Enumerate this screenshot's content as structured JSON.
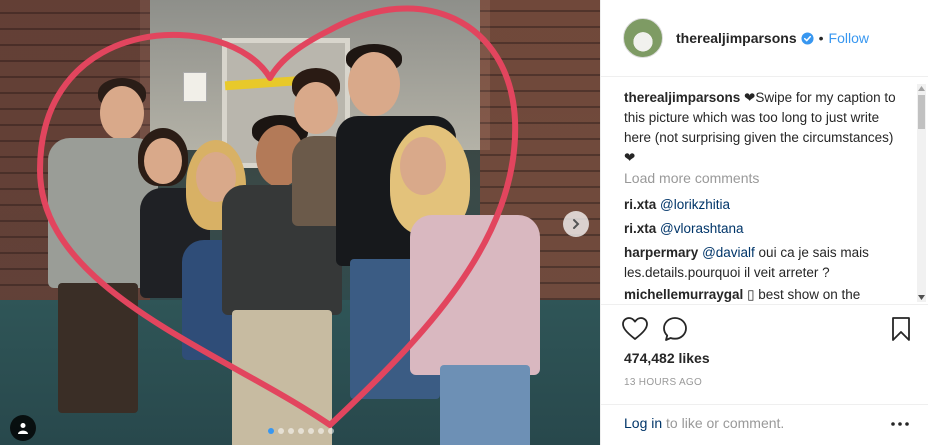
{
  "post": {
    "username": "therealjimparsons",
    "follow_label": "Follow",
    "separator": "•",
    "likes": "474,482 likes",
    "timestamp": "13 HOURS AGO",
    "load_more": "Load more comments",
    "login_link": "Log in",
    "login_suffix": " to like or comment."
  },
  "comments": [
    {
      "user": "therealjimparsons",
      "text": " ❤Swipe for my caption to this picture which was too long to just write here (not surprising given the circumstances) ❤"
    },
    {
      "user": "ri.xta",
      "mention": "@lorikzhitia",
      "text": ""
    },
    {
      "user": "ri.xta",
      "mention": "@vlorashtana",
      "text": ""
    },
    {
      "user": "harpermary",
      "mention": "@davialf",
      "text": " oui ca je sais mais les.details.pourquoi il veit arreter ?"
    },
    {
      "user": "michellemurraygal",
      "mention": "",
      "text": " ▯ best show on the"
    }
  ],
  "carousel": {
    "dot_count": 7,
    "active_index": 0
  },
  "icons": {
    "avatar": "avatar-image",
    "verified": "verified-badge-icon",
    "like": "heart-outline-icon",
    "comment": "comment-bubble-icon",
    "save": "bookmark-icon",
    "more": "more-options-icon",
    "next": "chevron-right-icon",
    "tag": "user-tag-icon"
  },
  "colors": {
    "accent": "#3897f0",
    "heart_stroke": "#e2455e",
    "mention": "#003569",
    "muted": "#999999"
  }
}
